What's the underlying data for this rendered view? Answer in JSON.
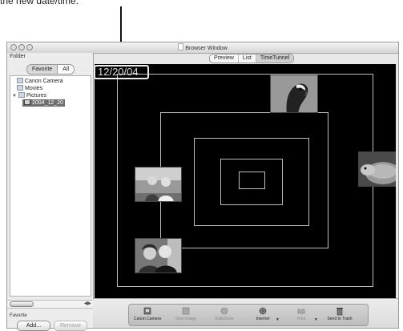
{
  "callout": {
    "text": "the new date/time."
  },
  "window": {
    "title": "Browser Window"
  },
  "sidebar": {
    "folder_label": "Folder",
    "tabs": [
      "Favorite",
      "All"
    ],
    "tree": [
      {
        "label": "Canon Camera",
        "icon": "camera-icon"
      },
      {
        "label": "Movies",
        "icon": "folder-icon"
      },
      {
        "label": "Pictures",
        "icon": "folder-icon"
      },
      {
        "label": "2004_12_20",
        "icon": "folder-icon",
        "selected": true
      }
    ],
    "favorite_label": "Favorite",
    "add_button": "Add...",
    "remove_button": "Remove"
  },
  "view_tabs": [
    "Preview",
    "List",
    "TimeTunnel"
  ],
  "canvas": {
    "date": "12/20/04"
  },
  "toolbar": {
    "items": [
      {
        "label": "Canon Camera",
        "icon": "camera-icon",
        "enabled": true
      },
      {
        "label": "View Image",
        "icon": "image-icon",
        "enabled": false
      },
      {
        "label": "SlideShow",
        "icon": "slideshow-icon",
        "enabled": false
      },
      {
        "label": "Internet",
        "icon": "globe-icon",
        "enabled": true
      },
      {
        "label": "Print",
        "icon": "printer-icon",
        "enabled": false
      },
      {
        "label": "Send to Trash",
        "icon": "trash-icon",
        "enabled": true
      }
    ]
  },
  "colors": {
    "canvas_bg": "#000000",
    "selection": "#6d6d6d",
    "frame": "#bdbdbd"
  }
}
